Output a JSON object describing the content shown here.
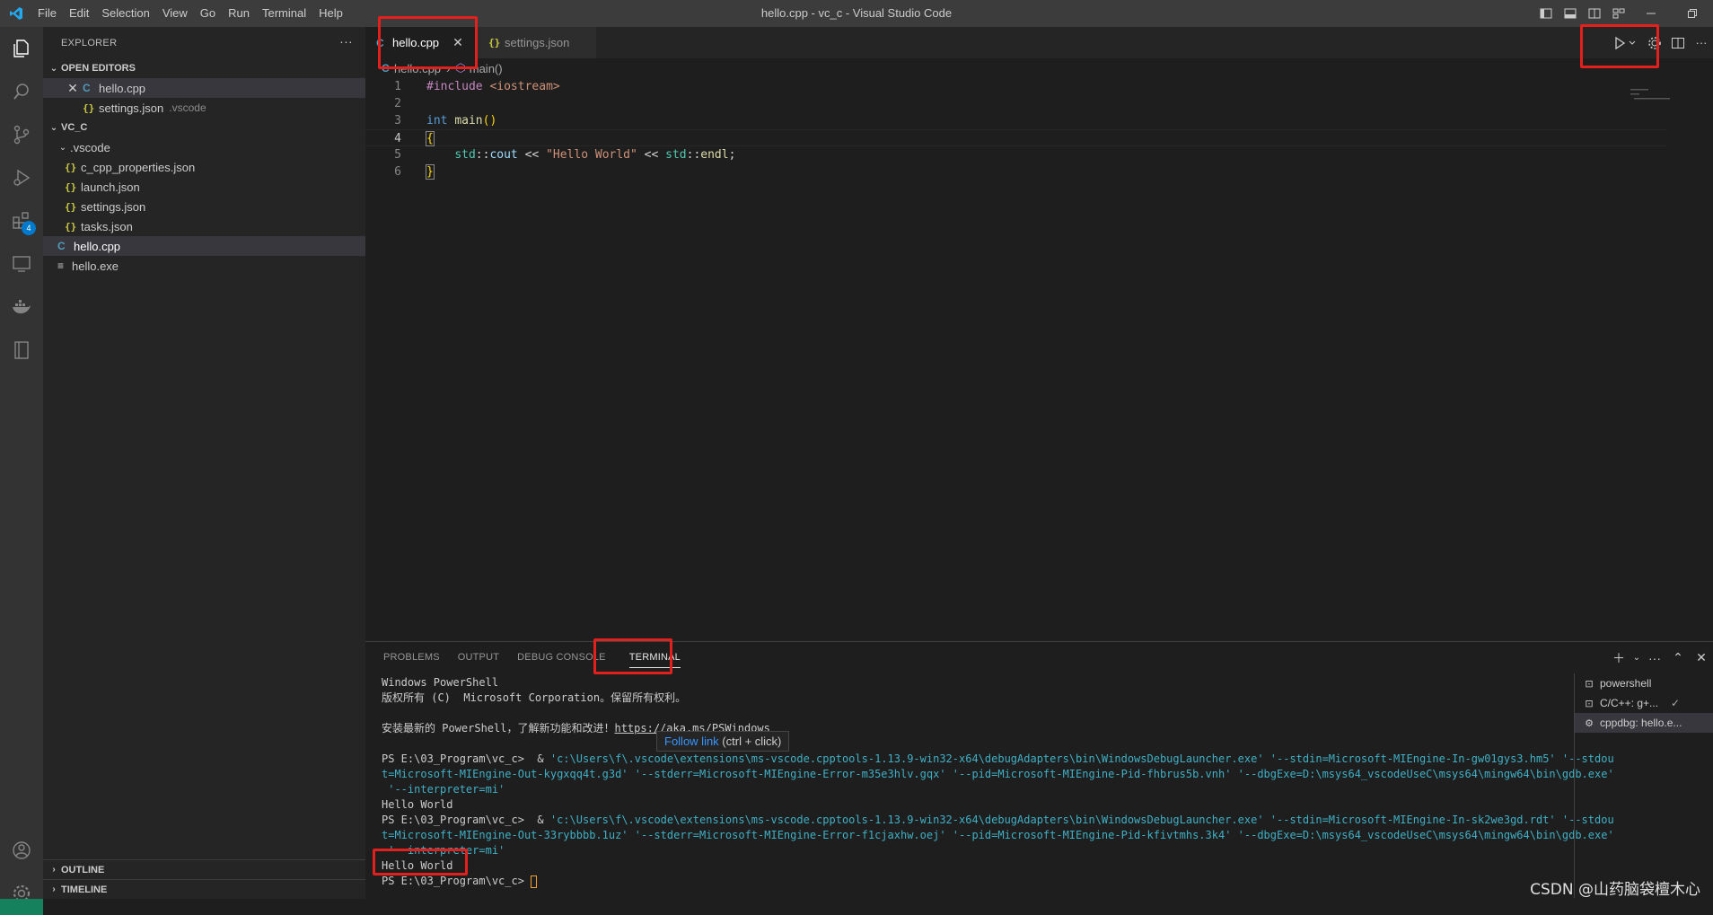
{
  "window": {
    "title": "hello.cpp - vc_c - Visual Studio Code"
  },
  "menu": [
    "File",
    "Edit",
    "Selection",
    "View",
    "Go",
    "Run",
    "Terminal",
    "Help"
  ],
  "sidebar": {
    "title": "EXPLORER",
    "open_editors_label": "OPEN EDITORS",
    "open_editors": [
      {
        "name": "hello.cpp",
        "desc": "",
        "icon": "cpp-icon"
      },
      {
        "name": "settings.json",
        "desc": ".vscode",
        "icon": "json-icon"
      }
    ],
    "folder_label": "VC_C",
    "tree": [
      {
        "name": ".vscode",
        "type": "folder"
      },
      {
        "name": "c_cpp_properties.json",
        "type": "json"
      },
      {
        "name": "launch.json",
        "type": "json"
      },
      {
        "name": "settings.json",
        "type": "json"
      },
      {
        "name": "tasks.json",
        "type": "json"
      },
      {
        "name": "hello.cpp",
        "type": "cpp"
      },
      {
        "name": "hello.exe",
        "type": "exe"
      }
    ],
    "outline_label": "OUTLINE",
    "timeline_label": "TIMELINE"
  },
  "activity": {
    "extensions_badge": "4"
  },
  "editor": {
    "tabs": [
      {
        "label": "hello.cpp",
        "active": true
      },
      {
        "label": "settings.json",
        "active": false
      }
    ],
    "breadcrumb": {
      "file": "hello.cpp",
      "symbol": "main()"
    },
    "line_numbers": [
      "1",
      "2",
      "3",
      "4",
      "5",
      "6"
    ]
  },
  "panel": {
    "tabs": [
      "PROBLEMS",
      "OUTPUT",
      "DEBUG CONSOLE",
      "TERMINAL"
    ],
    "active_tab": "TERMINAL",
    "terminal_lines": {
      "l1": "Windows PowerShell",
      "l2": "版权所有 (C)  Microsoft Corporation。保留所有权利。",
      "l3_prefix": "安装最新的 PowerShell，了解新功能和改进！",
      "l3_link": "https://aka.ms/PSWindows",
      "run1_prompt": "PS E:\\03_Program\\vc_c>  & ",
      "run1_a": "'c:\\Users\\f\\.vscode\\extensions\\ms-vscode.cpptools-1.13.9-win32-x64\\debugAdapters\\bin\\WindowsDebugLauncher.exe' '--stdin=Microsoft-MIEngine-In-gw01gys3.hm5' '--stdou",
      "run1_b": "t=Microsoft-MIEngine-Out-kygxqq4t.g3d' '--stderr=Microsoft-MIEngine-Error-m35e3hlv.gqx' '--pid=Microsoft-MIEngine-Pid-fhbrus5b.vnh' '--dbgExe=D:\\msys64_vscodeUseC\\msys64\\mingw64\\bin\\gdb.exe'",
      "run1_c": " '--interpreter=mi'",
      "out1": "Hello World",
      "run2_prompt": "PS E:\\03_Program\\vc_c>  & ",
      "run2_a": "'c:\\Users\\f\\.vscode\\extensions\\ms-vscode.cpptools-1.13.9-win32-x64\\debugAdapters\\bin\\WindowsDebugLauncher.exe' '--stdin=Microsoft-MIEngine-In-sk2we3gd.rdt' '--stdou",
      "run2_b": "t=Microsoft-MIEngine-Out-33rybbbb.1uz' '--stderr=Microsoft-MIEngine-Error-f1cjaxhw.oej' '--pid=Microsoft-MIEngine-Pid-kfivtmhs.3k4' '--dbgExe=D:\\msys64_vscodeUseC\\msys64\\mingw64\\bin\\gdb.exe'",
      "run2_c": " '--interpreter=mi'",
      "out2": "Hello World",
      "final_prompt": "PS E:\\03_Program\\vc_c> "
    },
    "tooltip": {
      "link": "Follow link",
      "hint": " (ctrl + click)"
    },
    "terminal_list": [
      {
        "label": "powershell",
        "icon": "terminal-icon"
      },
      {
        "label": "C/C++: g+...",
        "icon": "terminal-icon"
      },
      {
        "label": "cppdbg: hello.e...",
        "icon": "gear-icon"
      }
    ]
  },
  "watermark": "CSDN @山药脑袋檀木心",
  "colors": {
    "highlight_box": "#e2201d",
    "accent": "#007acc"
  }
}
